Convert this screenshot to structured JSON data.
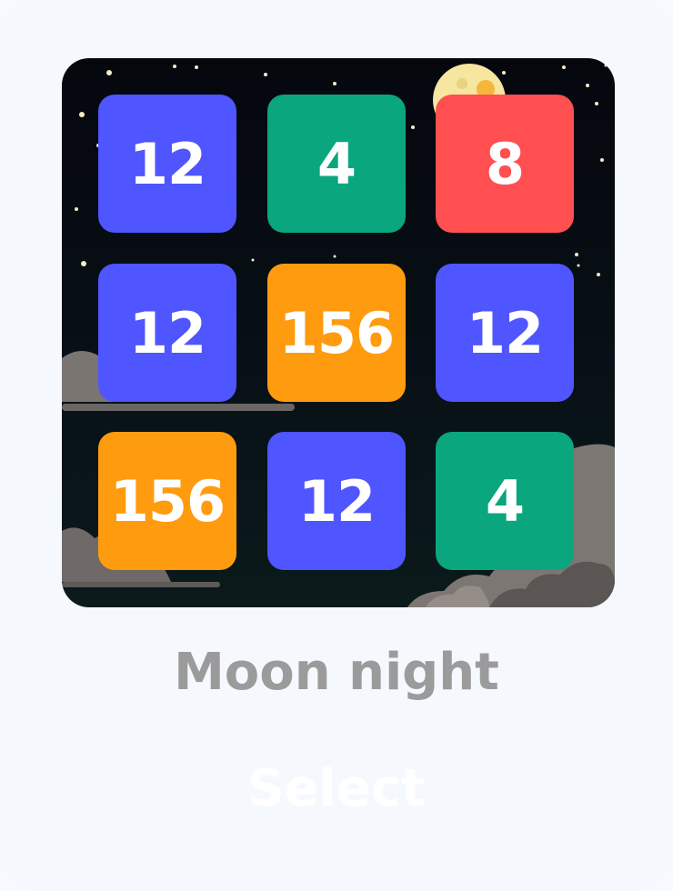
{
  "theme": {
    "name": "Moon night",
    "select_label": "Select"
  },
  "board": {
    "rows": 3,
    "cols": 3,
    "tiles": [
      {
        "value": "12",
        "color": "#4f55ff"
      },
      {
        "value": "4",
        "color": "#0aa67e"
      },
      {
        "value": "8",
        "color": "#ff4f50"
      },
      {
        "value": "12",
        "color": "#4f55ff"
      },
      {
        "value": "156",
        "color": "#ff9b0e"
      },
      {
        "value": "12",
        "color": "#4f55ff"
      },
      {
        "value": "156",
        "color": "#ff9b0e"
      },
      {
        "value": "12",
        "color": "#4f55ff"
      },
      {
        "value": "4",
        "color": "#0aa67e"
      }
    ]
  },
  "colors": {
    "card_background": "#f5f9fe",
    "theme_name_text": "#9b9b9b",
    "select_text": "#ffffff",
    "sky": "#05070d",
    "moon": "#f6e6a0"
  }
}
